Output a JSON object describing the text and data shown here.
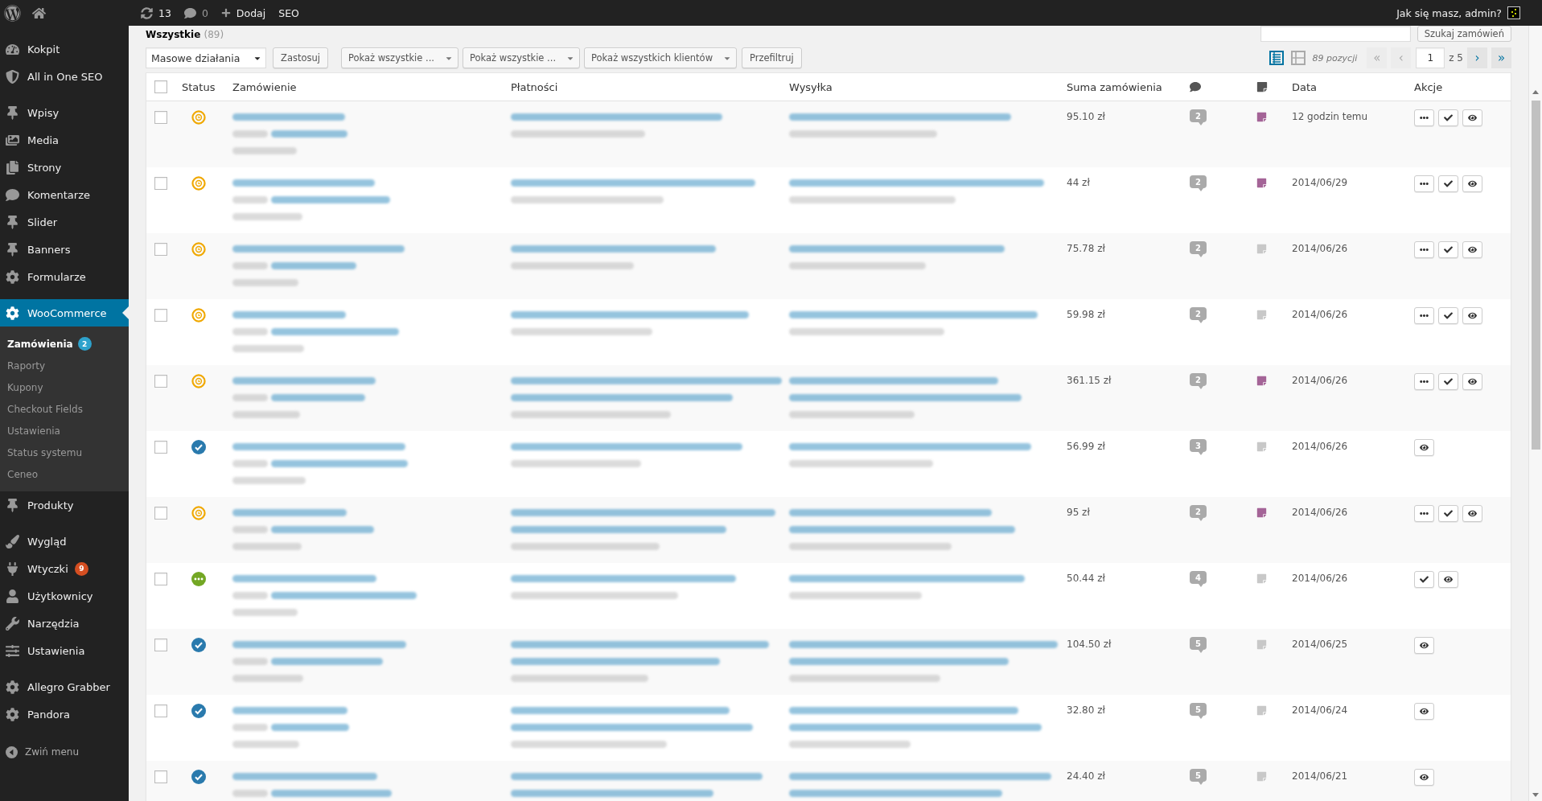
{
  "admin_bar": {
    "updates": "13",
    "comments": {
      "count": "0",
      "dimmed": true
    },
    "new": "Dodaj",
    "seo": "SEO",
    "greeting": "Jak się masz, admin?"
  },
  "sidebar": {
    "groups": [
      [
        {
          "label": "Kokpit",
          "selected": false
        },
        {
          "label": "All in One SEO",
          "selected": false
        }
      ],
      [
        {
          "label": "Wpisy",
          "selected": false
        },
        {
          "label": "Media",
          "selected": false
        },
        {
          "label": "Strony",
          "selected": false
        },
        {
          "label": "Komentarze",
          "selected": false
        },
        {
          "label": "Slider",
          "selected": false
        },
        {
          "label": "Banners",
          "selected": false
        },
        {
          "label": "Formularze",
          "selected": false
        }
      ],
      [
        {
          "label": "WooCommerce",
          "selected": true,
          "children": [
            {
              "label": "Zamówienia",
              "selected": true,
              "badge": "2"
            },
            {
              "label": "Raporty",
              "selected": false
            },
            {
              "label": "Kupony",
              "selected": false
            },
            {
              "label": "Checkout Fields",
              "selected": false
            },
            {
              "label": "Ustawienia",
              "selected": false
            },
            {
              "label": "Status systemu",
              "selected": false
            },
            {
              "label": "Ceneo",
              "selected": false
            }
          ]
        },
        {
          "label": "Produkty",
          "selected": false
        }
      ],
      [
        {
          "label": "Wygląd",
          "selected": false
        },
        {
          "label": "Wtyczki",
          "selected": false,
          "badge": "9"
        },
        {
          "label": "Użytkownicy",
          "selected": false
        },
        {
          "label": "Narzędzia",
          "selected": false
        },
        {
          "label": "Ustawienia",
          "selected": false
        }
      ],
      [
        {
          "label": "Allegro Grabber",
          "selected": false
        },
        {
          "label": "Pandora",
          "selected": false
        }
      ]
    ],
    "collapse": "Zwiń menu"
  },
  "views": [
    {
      "label": "Wszystkie",
      "count": "(89)",
      "selected": true
    }
  ],
  "search": {
    "button": "Szukaj zamówień"
  },
  "toolbar": {
    "bulk_action": "Masowe działania",
    "apply": "Zastosuj",
    "filters": [
      "Pokaż wszystkie ...",
      "Pokaż wszystkie ...",
      "Pokaż wszystkich klientów"
    ],
    "filter_button": "Przefiltruj",
    "view_modes": [
      {
        "selected": true
      },
      {
        "selected": false
      }
    ],
    "items_count": "89 pozycji",
    "pagination": {
      "first": {
        "label": "«",
        "disabled": true
      },
      "prev": {
        "label": "‹",
        "disabled": true
      },
      "page": "1",
      "total": "z 5",
      "next": {
        "label": "›",
        "disabled": false
      },
      "last": {
        "label": "»",
        "disabled": false
      }
    }
  },
  "table": {
    "select_all": {
      "checked": false
    },
    "columns": [
      {
        "kind": "text",
        "label": "Status"
      },
      {
        "kind": "text",
        "label": "Zamówienie"
      },
      {
        "kind": "text",
        "label": "Płatności"
      },
      {
        "kind": "text",
        "label": "Wysyłka"
      },
      {
        "kind": "text",
        "label": "Suma zamówienia"
      },
      {
        "kind": "comments"
      },
      {
        "kind": "notes"
      },
      {
        "kind": "text",
        "label": "Data"
      },
      {
        "kind": "text",
        "label": "Akcje"
      }
    ],
    "rows": [
      {
        "checked": false,
        "status": {
          "kind": "pending"
        },
        "order_lines": [
          {
            "kind": "link"
          },
          {
            "kind": "email"
          },
          {
            "kind": "muted"
          }
        ],
        "billing_lines": [
          {
            "kind": "link"
          },
          {
            "kind": "muted"
          }
        ],
        "shipping_lines": [
          {
            "kind": "link"
          },
          {
            "kind": "muted"
          }
        ],
        "total": "95.10 zł",
        "comments": "2",
        "has_note": true,
        "date": "12 godzin temu",
        "actions": [
          {
            "kind": "processing"
          },
          {
            "kind": "complete"
          },
          {
            "kind": "view"
          }
        ]
      },
      {
        "checked": false,
        "status": {
          "kind": "pending"
        },
        "order_lines": [
          {
            "kind": "link"
          },
          {
            "kind": "email"
          },
          {
            "kind": "muted"
          }
        ],
        "billing_lines": [
          {
            "kind": "link"
          },
          {
            "kind": "muted"
          }
        ],
        "shipping_lines": [
          {
            "kind": "link"
          },
          {
            "kind": "muted"
          }
        ],
        "total": "44 zł",
        "comments": "2",
        "has_note": true,
        "date": "2014/06/29",
        "actions": [
          {
            "kind": "processing"
          },
          {
            "kind": "complete"
          },
          {
            "kind": "view"
          }
        ]
      },
      {
        "checked": false,
        "status": {
          "kind": "pending"
        },
        "order_lines": [
          {
            "kind": "link"
          },
          {
            "kind": "email"
          },
          {
            "kind": "muted"
          }
        ],
        "billing_lines": [
          {
            "kind": "link"
          },
          {
            "kind": "muted"
          }
        ],
        "shipping_lines": [
          {
            "kind": "link"
          },
          {
            "kind": "muted"
          }
        ],
        "total": "75.78 zł",
        "comments": "2",
        "has_note": false,
        "date": "2014/06/26",
        "actions": [
          {
            "kind": "processing"
          },
          {
            "kind": "complete"
          },
          {
            "kind": "view"
          }
        ]
      },
      {
        "checked": false,
        "status": {
          "kind": "pending"
        },
        "order_lines": [
          {
            "kind": "link"
          },
          {
            "kind": "email"
          },
          {
            "kind": "muted"
          }
        ],
        "billing_lines": [
          {
            "kind": "link"
          },
          {
            "kind": "muted"
          }
        ],
        "shipping_lines": [
          {
            "kind": "link"
          },
          {
            "kind": "muted"
          }
        ],
        "total": "59.98 zł",
        "comments": "2",
        "has_note": false,
        "date": "2014/06/26",
        "actions": [
          {
            "kind": "processing"
          },
          {
            "kind": "complete"
          },
          {
            "kind": "view"
          }
        ]
      },
      {
        "checked": false,
        "status": {
          "kind": "pending"
        },
        "order_lines": [
          {
            "kind": "link"
          },
          {
            "kind": "email"
          },
          {
            "kind": "muted"
          }
        ],
        "billing_lines": [
          {
            "kind": "link"
          },
          {
            "kind": "link"
          },
          {
            "kind": "muted"
          }
        ],
        "shipping_lines": [
          {
            "kind": "link"
          },
          {
            "kind": "link"
          },
          {
            "kind": "muted"
          }
        ],
        "total": "361.15 zł",
        "comments": "2",
        "has_note": true,
        "date": "2014/06/26",
        "actions": [
          {
            "kind": "processing"
          },
          {
            "kind": "complete"
          },
          {
            "kind": "view"
          }
        ]
      },
      {
        "checked": false,
        "status": {
          "kind": "completed"
        },
        "order_lines": [
          {
            "kind": "link"
          },
          {
            "kind": "email"
          },
          {
            "kind": "muted"
          }
        ],
        "billing_lines": [
          {
            "kind": "link"
          },
          {
            "kind": "muted"
          }
        ],
        "shipping_lines": [
          {
            "kind": "link"
          },
          {
            "kind": "muted"
          }
        ],
        "total": "56.99 zł",
        "comments": "3",
        "has_note": false,
        "date": "2014/06/26",
        "actions": [
          {
            "kind": "view"
          }
        ]
      },
      {
        "checked": false,
        "status": {
          "kind": "pending"
        },
        "order_lines": [
          {
            "kind": "link"
          },
          {
            "kind": "email"
          },
          {
            "kind": "muted"
          }
        ],
        "billing_lines": [
          {
            "kind": "link"
          },
          {
            "kind": "link"
          },
          {
            "kind": "muted"
          }
        ],
        "shipping_lines": [
          {
            "kind": "link"
          },
          {
            "kind": "link"
          },
          {
            "kind": "muted"
          }
        ],
        "total": "95 zł",
        "comments": "2",
        "has_note": true,
        "date": "2014/06/26",
        "actions": [
          {
            "kind": "processing"
          },
          {
            "kind": "complete"
          },
          {
            "kind": "view"
          }
        ]
      },
      {
        "checked": false,
        "status": {
          "kind": "processing"
        },
        "order_lines": [
          {
            "kind": "link"
          },
          {
            "kind": "email"
          },
          {
            "kind": "muted"
          }
        ],
        "billing_lines": [
          {
            "kind": "link"
          },
          {
            "kind": "muted"
          }
        ],
        "shipping_lines": [
          {
            "kind": "link"
          },
          {
            "kind": "muted"
          }
        ],
        "total": "50.44 zł",
        "comments": "4",
        "has_note": false,
        "date": "2014/06/26",
        "actions": [
          {
            "kind": "complete"
          },
          {
            "kind": "view"
          }
        ]
      },
      {
        "checked": false,
        "status": {
          "kind": "completed"
        },
        "order_lines": [
          {
            "kind": "link"
          },
          {
            "kind": "email"
          },
          {
            "kind": "muted"
          }
        ],
        "billing_lines": [
          {
            "kind": "link"
          },
          {
            "kind": "link"
          },
          {
            "kind": "muted"
          }
        ],
        "shipping_lines": [
          {
            "kind": "link"
          },
          {
            "kind": "link"
          },
          {
            "kind": "muted"
          }
        ],
        "total": "104.50 zł",
        "comments": "5",
        "has_note": false,
        "date": "2014/06/25",
        "actions": [
          {
            "kind": "view"
          }
        ]
      },
      {
        "checked": false,
        "status": {
          "kind": "completed"
        },
        "order_lines": [
          {
            "kind": "link"
          },
          {
            "kind": "email"
          },
          {
            "kind": "muted"
          }
        ],
        "billing_lines": [
          {
            "kind": "link"
          },
          {
            "kind": "link"
          },
          {
            "kind": "muted"
          }
        ],
        "shipping_lines": [
          {
            "kind": "link"
          },
          {
            "kind": "link"
          },
          {
            "kind": "muted"
          }
        ],
        "total": "32.80 zł",
        "comments": "5",
        "has_note": false,
        "date": "2014/06/24",
        "actions": [
          {
            "kind": "view"
          }
        ]
      },
      {
        "checked": false,
        "status": {
          "kind": "completed"
        },
        "order_lines": [
          {
            "kind": "link"
          },
          {
            "kind": "email"
          }
        ],
        "billing_lines": [
          {
            "kind": "link"
          },
          {
            "kind": "link"
          }
        ],
        "shipping_lines": [
          {
            "kind": "link"
          },
          {
            "kind": "link"
          }
        ],
        "total": "24.40 zł",
        "comments": "5",
        "has_note": false,
        "date": "2014/06/21",
        "actions": [
          {
            "kind": "view"
          }
        ]
      }
    ]
  }
}
